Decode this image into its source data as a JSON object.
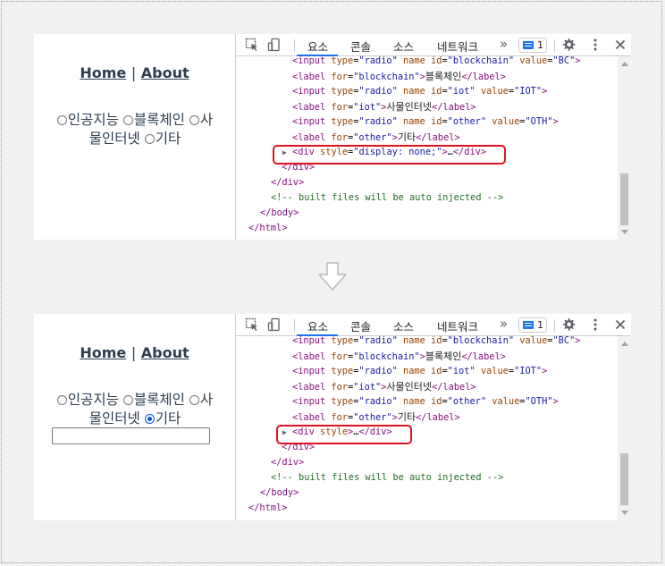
{
  "app": {
    "nav": {
      "home": "Home",
      "separator": "|",
      "about": "About"
    },
    "radios_line1": [
      "인공지능",
      "블록체인",
      "사"
    ],
    "radios_line2": [
      "물인터넷",
      "기타"
    ]
  },
  "devtools": {
    "tabs": [
      "요소",
      "콘솔",
      "소스",
      "네트워크"
    ],
    "more": "»",
    "issues_count": "1",
    "lines": {
      "input_blockchain": {
        "tag": "input",
        "type_attr": "type",
        "type_val": "\"radio\"",
        "name_attr": "name",
        "id_attr": "id",
        "id_val": "\"blockchain\"",
        "value_attr": "value",
        "value_val": "\"BC\""
      },
      "label_blockchain": {
        "for_val": "\"blockchain\"",
        "text": "블록체인"
      },
      "input_iot": {
        "id_val": "\"iot\"",
        "value_val": "\"IOT\""
      },
      "label_iot": {
        "for_val": "\"iot\"",
        "text": "사물인터넷"
      },
      "input_other": {
        "id_val": "\"other\"",
        "value_val": "\"OTH\""
      },
      "label_other": {
        "for_val": "\"other\"",
        "text": "기타"
      },
      "div_hidden_style": "\"display: none;\"",
      "ellipsis": "…",
      "comment": "<!-- built files will be auto injected -->"
    }
  },
  "colors": {
    "highlight": "#e0121d",
    "accent": "#1a73e8"
  }
}
